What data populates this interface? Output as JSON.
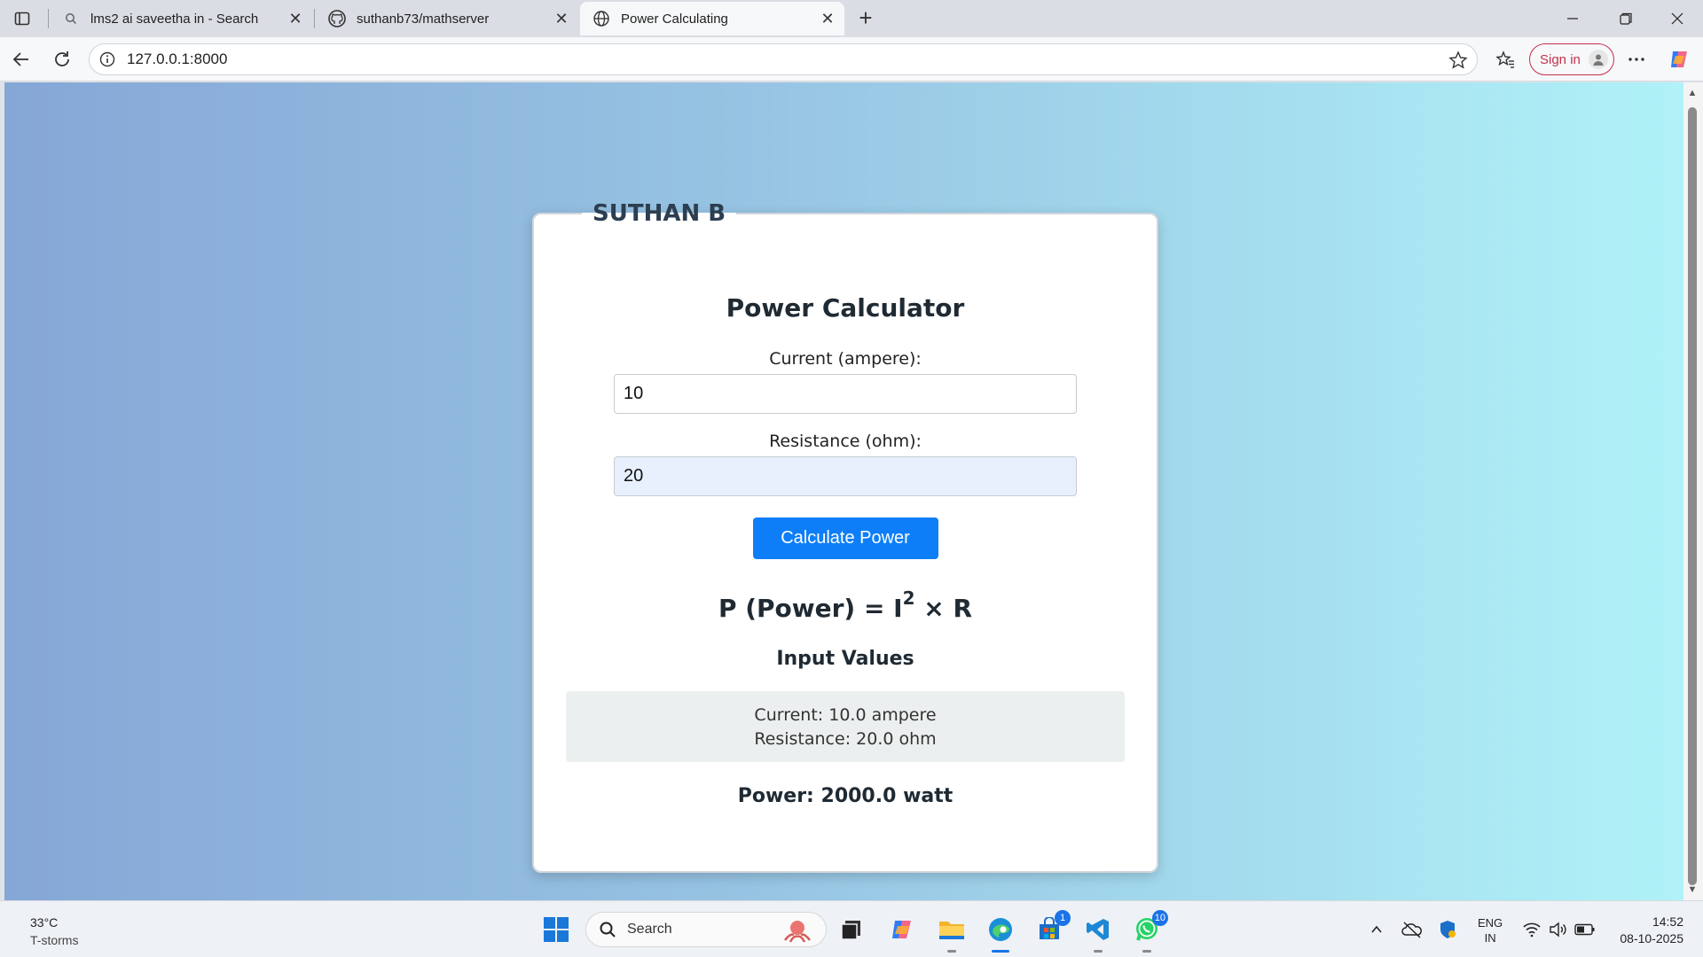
{
  "browser": {
    "tabs": [
      {
        "title": "lms2 ai saveetha in - Search",
        "icon": "search-icon"
      },
      {
        "title": "suthanb73/mathserver",
        "icon": "github-icon"
      },
      {
        "title": "Power Calculating",
        "icon": "globe-icon",
        "active": true
      }
    ],
    "url": "127.0.0.1:8000",
    "sign_in_label": "Sign in"
  },
  "page": {
    "legend": "SUTHAN B",
    "heading": "Power Calculator",
    "current_label": "Current (ampere):",
    "current_value": "10",
    "resistance_label": "Resistance (ohm):",
    "resistance_value": "20",
    "button_label": "Calculate Power",
    "formula_prefix": "P (Power) = I",
    "formula_exponent": "2",
    "formula_suffix": " × R",
    "input_values_heading": "Input Values",
    "current_result": "Current: 10.0 ampere",
    "resistance_result": "Resistance: 20.0 ohm",
    "power_result": "Power: 2000.0 watt"
  },
  "taskbar": {
    "temperature": "33°C",
    "condition": "T-storms",
    "search_placeholder": "Search",
    "store_badge": "1",
    "whatsapp_badge": "10",
    "lang_line1": "ENG",
    "lang_line2": "IN",
    "time": "14:52",
    "date": "08-10-2025"
  },
  "colors": {
    "button": "#0d7ef8",
    "signin": "#c4314b",
    "gradient_left": "#86a7d6",
    "gradient_right": "#b0f2f8"
  }
}
